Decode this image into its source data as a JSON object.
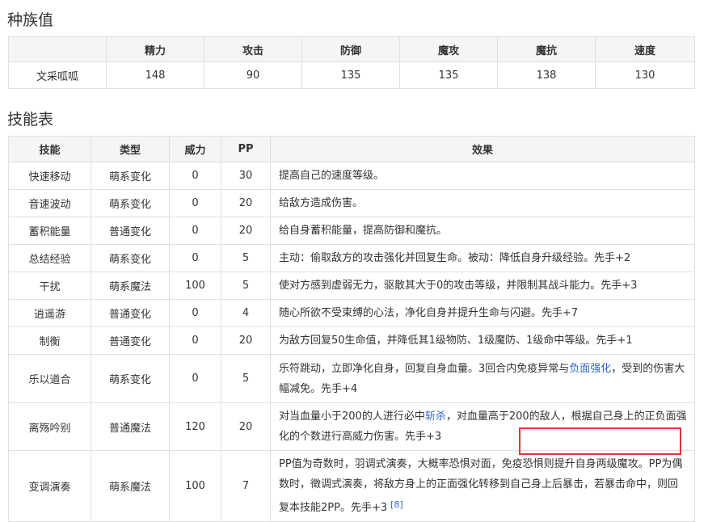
{
  "stats_section": {
    "title": "种族值",
    "headers": [
      "",
      "精力",
      "攻击",
      "防御",
      "魔攻",
      "魔抗",
      "速度"
    ],
    "row": [
      "文采呱呱",
      "148",
      "90",
      "135",
      "135",
      "138",
      "130"
    ]
  },
  "skills_section": {
    "title": "技能表",
    "headers": [
      "技能",
      "类型",
      "威力",
      "PP",
      "效果"
    ],
    "rows": [
      {
        "name": "快速移动",
        "type": "萌系变化",
        "power": "0",
        "pp": "30",
        "effect_a": "提高自己的速度等级。"
      },
      {
        "name": "音速波动",
        "type": "萌系变化",
        "power": "0",
        "pp": "20",
        "effect_a": "给敌方造成伤害。"
      },
      {
        "name": "蓄积能量",
        "type": "普通变化",
        "power": "0",
        "pp": "20",
        "effect_a": "给自身蓄积能量，提高防御和魔抗。"
      },
      {
        "name": "总结经验",
        "type": "萌系变化",
        "power": "0",
        "pp": "5",
        "effect_a": "主动：偷取敌方的攻击强化并回复生命。被动：降低自身升级经验。先手+2"
      },
      {
        "name": "干扰",
        "type": "萌系魔法",
        "power": "100",
        "pp": "5",
        "effect_a": "使对方感到虚弱无力，驱散其大于0的攻击等级，并限制其战斗能力。先手+3"
      },
      {
        "name": "逍遥游",
        "type": "普通变化",
        "power": "0",
        "pp": "4",
        "effect_a": "随心所欲不受束缚的心法，净化自身并提升生命与闪避。先手+7"
      },
      {
        "name": "制衡",
        "type": "普通变化",
        "power": "0",
        "pp": "20",
        "effect_a": "为敌方回复50生命值，并降低其1级物防、1级魔防、1级命中等级。先手+1"
      },
      {
        "name": "乐以道合",
        "type": "萌系变化",
        "power": "0",
        "pp": "5",
        "effect_a": "乐符跳动，立即净化自身，回复自身血量。3回合内免疫异常与",
        "link": "负面强化",
        "effect_b": "，受到的伤害大幅减免。先手+4"
      },
      {
        "name": "离殇吟别",
        "type": "普通魔法",
        "power": "120",
        "pp": "20",
        "effect_a": "对当血量小于200的人进行必中",
        "link": "斩杀",
        "effect_b": "，对血量高于200的敌人，根据自己身上的正负面强化的个数进行高威力伤害。先手+3"
      },
      {
        "name": "变调演奏",
        "type": "萌系魔法",
        "power": "100",
        "pp": "7",
        "effect_a": "PP值为奇数时，羽调式演奏，大概率恐惧对面，免疫恐惧则提升自身两级魔攻。PP为偶数时，徵调式演奏，将敌方身上的正面强化转移到自己身上后暴击，若暴击命中，则回复本技能2PP。先手+3",
        "ref": "[8]"
      }
    ]
  },
  "accent_color": "#e8303a",
  "link_color": "#3366cc"
}
